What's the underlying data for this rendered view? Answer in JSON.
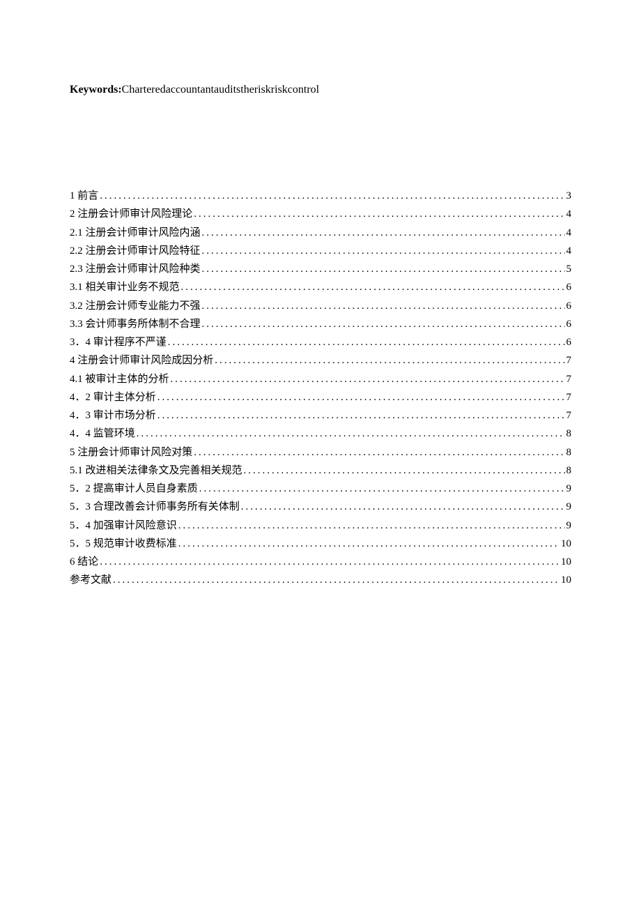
{
  "keywords": {
    "label": "Keywords:",
    "value": "Charteredaccountantauditstheriskriskcontrol"
  },
  "toc": [
    {
      "title": "1 前言",
      "page": "3"
    },
    {
      "title": "2 注册会计师审计风险理论",
      "page": "4"
    },
    {
      "title": "2.1 注册会计师审计风险内涵",
      "page": "4"
    },
    {
      "title": "2.2 注册会计师审计风险特征",
      "page": "4"
    },
    {
      "title": "2.3 注册会计师审计风险种类",
      "page": "5"
    },
    {
      "title": "3.1 相关审计业务不规范",
      "page": "6"
    },
    {
      "title": "3.2 注册会计师专业能力不强",
      "page": "6"
    },
    {
      "title": "3.3 会计师事务所体制不合理",
      "page": "6"
    },
    {
      "title": "3．4 审计程序不严谨",
      "page": "6"
    },
    {
      "title": "4 注册会计师审计风险成因分析",
      "page": "7"
    },
    {
      "title": "4.1 被审计主体的分析",
      "page": "7"
    },
    {
      "title": "4．2 审计主体分析",
      "page": "7"
    },
    {
      "title": "4．3 审计市场分析",
      "page": "7"
    },
    {
      "title": "4．4 监管环境",
      "page": "8"
    },
    {
      "title": "5 注册会计师审计风险对策",
      "page": "8"
    },
    {
      "title": "5.1 改进相关法律条文及完善相关规范",
      "page": "8"
    },
    {
      "title": "5．2 提高审计人员自身素质",
      "page": "9"
    },
    {
      "title": "5．3 合理改善会计师事务所有关体制",
      "page": "9"
    },
    {
      "title": "5．4 加强审计风险意识",
      "page": "9"
    },
    {
      "title": "5．5 规范审计收费标准",
      "page": "10"
    },
    {
      "title": "6 结论",
      "page": "10"
    },
    {
      "title": "参考文献",
      "page": "10"
    }
  ]
}
